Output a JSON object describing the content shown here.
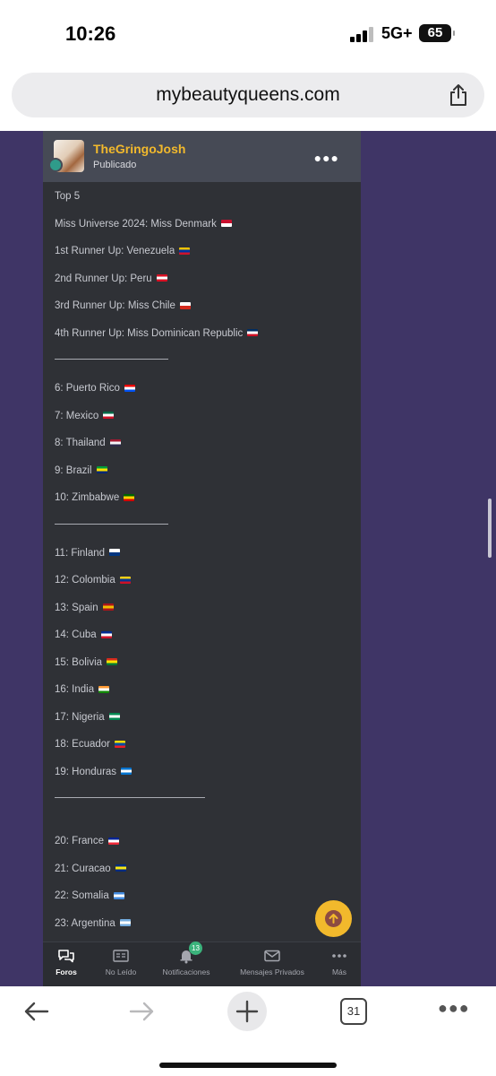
{
  "status_bar": {
    "time": "10:26",
    "network": "5G+",
    "battery": "65"
  },
  "browser": {
    "url": "mybeautyqueens.com",
    "open_tabs": "31"
  },
  "post": {
    "author": "TheGringoJosh",
    "status": "Publicado",
    "lines": [
      {
        "text": "Top 5"
      },
      {
        "text": "Miss Universe 2024: Miss Denmark",
        "flag": "denmark",
        "colors": [
          "#c8102e",
          "#ffffff"
        ]
      },
      {
        "text": "1st Runner Up: Venezuela",
        "flag": "venezuela",
        "colors": [
          "#f4c300",
          "#0033a0",
          "#cf142b"
        ]
      },
      {
        "text": "2nd Runner Up: Peru",
        "flag": "peru",
        "colors": [
          "#d91023",
          "#ffffff",
          "#d91023"
        ]
      },
      {
        "text": "3rd Runner Up: Miss Chile",
        "flag": "chile",
        "colors": [
          "#ffffff",
          "#d52b1e"
        ]
      },
      {
        "text": "4th Runner Up: Miss Dominican Republic",
        "flag": "dominican-republic",
        "colors": [
          "#002d62",
          "#ffffff",
          "#ce1126"
        ]
      },
      {
        "divider": true
      },
      {
        "text": "6: Puerto Rico",
        "flag": "puerto-rico",
        "colors": [
          "#ed0000",
          "#ffffff",
          "#0050f0"
        ]
      },
      {
        "text": "7: Mexico",
        "flag": "mexico",
        "colors": [
          "#006847",
          "#ffffff",
          "#ce1126"
        ]
      },
      {
        "text": "8: Thailand",
        "flag": "thailand",
        "colors": [
          "#a51931",
          "#f4f5f8",
          "#2d2a4a"
        ]
      },
      {
        "text": "9: Brazil",
        "flag": "brazil",
        "colors": [
          "#009c3b",
          "#ffdf00",
          "#002776"
        ]
      },
      {
        "text": "10: Zimbabwe",
        "flag": "zimbabwe",
        "colors": [
          "#006400",
          "#ffd200",
          "#d40000"
        ]
      },
      {
        "divider": true
      },
      {
        "text": "11: Finland",
        "flag": "finland",
        "colors": [
          "#ffffff",
          "#003580"
        ]
      },
      {
        "text": "12: Colombia",
        "flag": "colombia",
        "colors": [
          "#fcd116",
          "#003893",
          "#ce1126"
        ]
      },
      {
        "text": "13: Spain",
        "flag": "spain",
        "colors": [
          "#aa151b",
          "#f1bf00",
          "#aa151b"
        ]
      },
      {
        "text": "14: Cuba",
        "flag": "cuba",
        "colors": [
          "#002a8f",
          "#ffffff",
          "#cf142b"
        ]
      },
      {
        "text": "15: Bolivia",
        "flag": "bolivia",
        "colors": [
          "#d52b1e",
          "#f9e300",
          "#007934"
        ]
      },
      {
        "text": "16: India",
        "flag": "india",
        "colors": [
          "#ff9933",
          "#ffffff",
          "#138808"
        ]
      },
      {
        "text": "17: Nigeria",
        "flag": "nigeria",
        "colors": [
          "#008751",
          "#ffffff",
          "#008751"
        ]
      },
      {
        "text": "18: Ecuador",
        "flag": "ecuador",
        "colors": [
          "#ffdd00",
          "#034ea2",
          "#ed1c24"
        ]
      },
      {
        "text": "19: Honduras",
        "flag": "honduras",
        "colors": [
          "#0073cf",
          "#ffffff",
          "#0073cf"
        ]
      },
      {
        "divider": true,
        "wide": true
      },
      {
        "text": "20: France",
        "flag": "france",
        "colors": [
          "#002395",
          "#ffffff",
          "#ed2939"
        ]
      },
      {
        "text": "21: Curacao",
        "flag": "curacao",
        "colors": [
          "#002b7f",
          "#f9e814",
          "#002b7f"
        ]
      },
      {
        "text": "22: Somalia",
        "flag": "somalia",
        "colors": [
          "#4189dd",
          "#ffffff",
          "#4189dd"
        ]
      },
      {
        "text": "23: Argentina",
        "flag": "argentina",
        "colors": [
          "#74acdf",
          "#ffffff",
          "#74acdf"
        ]
      }
    ]
  },
  "forum_nav": [
    {
      "label": "Foros",
      "icon": "chat-bubbles-icon",
      "active": true
    },
    {
      "label": "No Leído",
      "icon": "newspaper-icon"
    },
    {
      "label": "Notificaciones",
      "icon": "bell-icon",
      "badge": "13"
    },
    {
      "label": "Mensajes Privados",
      "icon": "envelope-icon"
    },
    {
      "label": "Más",
      "icon": "ellipsis-icon"
    }
  ],
  "colors": {
    "accent": "#f2b92c",
    "page_bg": "#3f3566",
    "post_bg": "#2f3136",
    "badge": "#3bb37c"
  }
}
